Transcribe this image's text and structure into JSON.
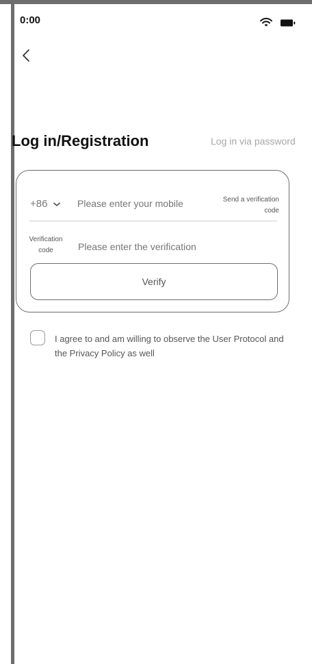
{
  "status_bar": {
    "time": "0:00",
    "icons": [
      "wifi-icon",
      "battery-icon"
    ]
  },
  "nav": {
    "back_icon": "chevron-left-icon"
  },
  "header": {
    "title": "Log in/Registration",
    "alt_login_link": "Log in via password"
  },
  "form": {
    "country_code": "+86",
    "country_dropdown_icon": "chevron-down-icon",
    "phone_placeholder": "Please enter your mobile",
    "send_code_label": "Send a verification code",
    "code_label": "Verification code",
    "code_placeholder": "Please enter the verification",
    "verify_button": "Verify"
  },
  "agreement": {
    "checked": false,
    "text": "I agree to and am willing to observe the User Protocol and the Privacy Policy as well"
  },
  "colors": {
    "frame": "#6d6d6d",
    "muted_text": "#a7a7a7",
    "border": "#6d6d6d"
  }
}
